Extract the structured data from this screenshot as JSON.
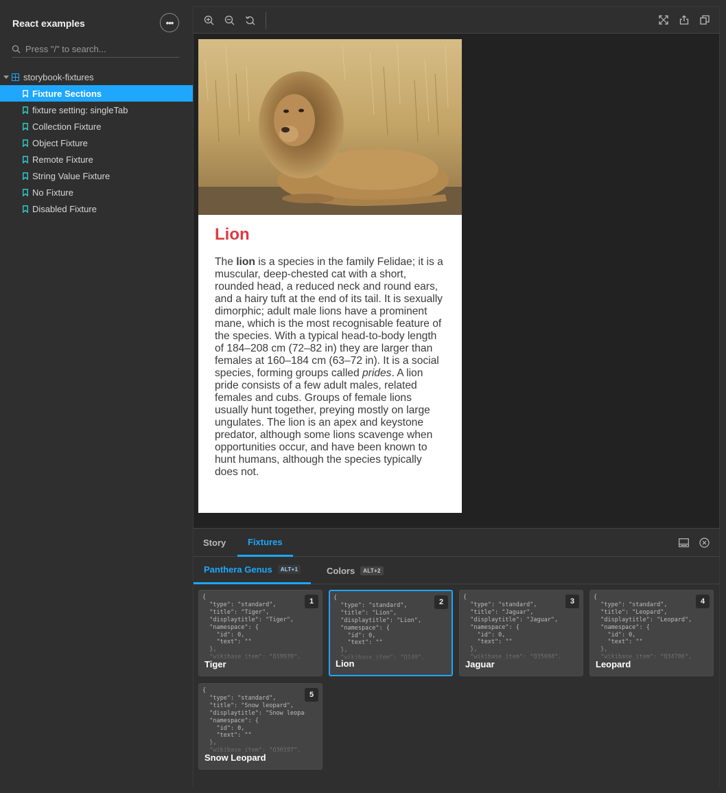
{
  "sidebar": {
    "title": "React examples",
    "search_placeholder": "Press \"/\" to search...",
    "root_label": "storybook-fixtures",
    "items": [
      {
        "label": "Fixture Sections",
        "active": true
      },
      {
        "label": "fixture setting: singleTab",
        "active": false
      },
      {
        "label": "Collection Fixture",
        "active": false
      },
      {
        "label": "Object Fixture",
        "active": false
      },
      {
        "label": "Remote Fixture",
        "active": false
      },
      {
        "label": "String Value Fixture",
        "active": false
      },
      {
        "label": "No Fixture",
        "active": false
      },
      {
        "label": "Disabled Fixture",
        "active": false
      }
    ]
  },
  "toolbar": {
    "left_icons": [
      "zoom-in-icon",
      "zoom-out-icon",
      "zoom-reset-icon"
    ],
    "right_icons": [
      "fullscreen-icon",
      "share-icon",
      "copy-icon"
    ]
  },
  "card": {
    "title": "Lion",
    "text_parts": [
      {
        "t": "The ",
        "style": "normal"
      },
      {
        "t": "lion",
        "style": "bold"
      },
      {
        "t": " is a species in the family Felidae; it is a muscular, deep-chested cat with a short, rounded head, a reduced neck and round ears, and a hairy tuft at the end of its tail. It is sexually dimorphic; adult male lions have a prominent mane, which is the most recognisable feature of the species. With a typical head-to-body length of 184–208 cm (72–82 in) they are larger than females at 160–184 cm (63–72 in). It is a social species, forming groups called ",
        "style": "normal"
      },
      {
        "t": "prides",
        "style": "italic"
      },
      {
        "t": ". A lion pride consists of a few adult males, related females and cubs. Groups of female lions usually hunt together, preying mostly on large ungulates. The lion is an apex and keystone predator, although some lions scavenge when opportunities occur, and have been known to hunt humans, although the species typically does not.",
        "style": "normal"
      }
    ],
    "colors": {
      "title": "#e03a3e",
      "text": "#3a3a3a"
    }
  },
  "panel": {
    "tabs": [
      {
        "label": "Story",
        "active": false
      },
      {
        "label": "Fixtures",
        "active": true
      }
    ],
    "icons": [
      "panel-toggle-icon",
      "close-panel-icon"
    ]
  },
  "fixtures": {
    "tabs": [
      {
        "label": "Panthera Genus",
        "shortcut": "ALT+1",
        "active": true
      },
      {
        "label": "Colors",
        "shortcut": "ALT+2",
        "active": false
      }
    ],
    "cards": [
      {
        "num": "1",
        "name": "Tiger",
        "selected": false,
        "json": "{\n  \"type\": \"standard\",\n  \"title\": \"Tiger\",\n  \"displaytitle\": \"Tiger\",\n  \"namespace\": {\n    \"id\": 0,\n    \"text\": \"\"\n  },\n  \"wikibase_item\": \"Q19939\","
      },
      {
        "num": "2",
        "name": "Lion",
        "selected": true,
        "json": "{\n  \"type\": \"standard\",\n  \"title\": \"Lion\",\n  \"displaytitle\": \"Lion\",\n  \"namespace\": {\n    \"id\": 0,\n    \"text\": \"\"\n  },\n  \"wikibase_item\": \"Q140\","
      },
      {
        "num": "3",
        "name": "Jaguar",
        "selected": false,
        "json": "{\n  \"type\": \"standard\",\n  \"title\": \"Jaguar\",\n  \"displaytitle\": \"Jaguar\",\n  \"namespace\": {\n    \"id\": 0,\n    \"text\": \"\"\n  },\n  \"wikibase_item\": \"Q35694\","
      },
      {
        "num": "4",
        "name": "Leopard",
        "selected": false,
        "json": "{\n  \"type\": \"standard\",\n  \"title\": \"Leopard\",\n  \"displaytitle\": \"Leopard\",\n  \"namespace\": {\n    \"id\": 0,\n    \"text\": \"\"\n  },\n  \"wikibase_item\": \"Q34706\","
      },
      {
        "num": "5",
        "name": "Snow Leopard",
        "selected": false,
        "json": "{\n  \"type\": \"standard\",\n  \"title\": \"Snow leopard\",\n  \"displaytitle\": \"Snow leopard\",\n  \"namespace\": {\n    \"id\": 0,\n    \"text\": \"\"\n  },\n  \"wikibase_item\": \"Q30197\","
      }
    ]
  },
  "theme": {
    "accent": "#1ea7fd",
    "background": "#2f2f2f",
    "canvas": "#222222"
  }
}
